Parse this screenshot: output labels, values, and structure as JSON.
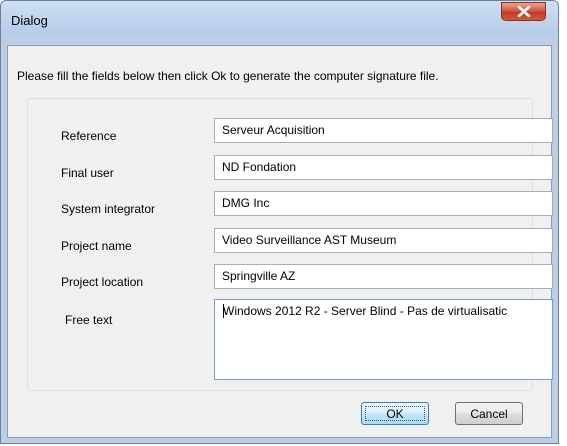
{
  "window": {
    "title": "Dialog",
    "close_icon": "close-icon"
  },
  "dialog": {
    "instructions": "Please fill the fields below then click Ok to generate the computer signature file.",
    "fields": [
      {
        "label": "Reference",
        "value": "Serveur Acquisition"
      },
      {
        "label": "Final user",
        "value": "ND Fondation"
      },
      {
        "label": "System integrator",
        "value": "DMG Inc"
      },
      {
        "label": "Project name",
        "value": "Video Surveillance AST Museum"
      },
      {
        "label": "Project location",
        "value": "Springville AZ"
      }
    ],
    "free_text": {
      "label": "Free text",
      "value": "Windows 2012 R2 - Server Blind -  Pas de virtualisatic"
    },
    "buttons": {
      "ok": "OK",
      "cancel": "Cancel"
    }
  },
  "colors": {
    "frame": "#bccde6",
    "client": "#f0f0f0",
    "close_button": "#c23a22",
    "default_button": "#3c7fb1"
  }
}
